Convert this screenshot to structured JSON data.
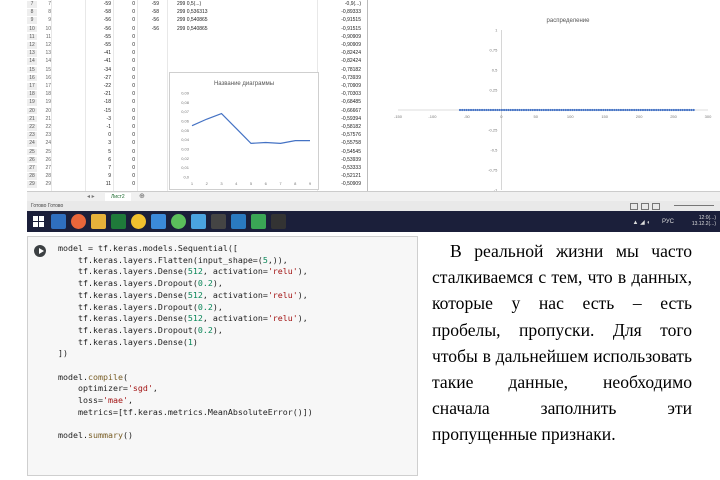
{
  "spreadsheet": {
    "rows": [
      {
        "n": "7",
        "a": "7",
        "b": "-59",
        "c": "0",
        "d": "-59",
        "e": "299",
        "f": "0,5(...)",
        "g": "-0,9(...)"
      },
      {
        "n": "8",
        "a": "8",
        "b": "-58",
        "c": "0",
        "d": "-58",
        "e": "299",
        "f": "0,536313",
        "g": "-0,89333"
      },
      {
        "n": "9",
        "a": "9",
        "b": "-56",
        "c": "0",
        "d": "-56",
        "e": "299",
        "f": "0,540865",
        "g": "-0,91515"
      },
      {
        "n": "10",
        "a": "10",
        "b": "-56",
        "c": "0",
        "d": "-56",
        "e": "299",
        "f": "0,540865",
        "g": "-0,91515"
      },
      {
        "n": "11",
        "a": "11",
        "b": "-55",
        "c": "0",
        "d": "",
        "e": "",
        "f": "",
        "g": "-0,90909"
      },
      {
        "n": "12",
        "a": "12",
        "b": "-55",
        "c": "0",
        "d": "",
        "e": "",
        "f": "",
        "g": "-0,90909"
      },
      {
        "n": "13",
        "a": "13",
        "b": "-41",
        "c": "0",
        "d": "",
        "e": "",
        "f": "",
        "g": "-0,82424"
      },
      {
        "n": "14",
        "a": "14",
        "b": "-41",
        "c": "0",
        "d": "",
        "e": "",
        "f": "",
        "g": "-0,82424"
      },
      {
        "n": "15",
        "a": "15",
        "b": "-34",
        "c": "0",
        "d": "",
        "e": "",
        "f": "",
        "g": "-0,78182"
      },
      {
        "n": "16",
        "a": "16",
        "b": "-27",
        "c": "0",
        "d": "",
        "e": "",
        "f": "",
        "g": "-0,73939"
      },
      {
        "n": "17",
        "a": "17",
        "b": "-22",
        "c": "0",
        "d": "",
        "e": "",
        "f": "",
        "g": "-0,70909"
      },
      {
        "n": "18",
        "a": "18",
        "b": "-21",
        "c": "0",
        "d": "",
        "e": "",
        "f": "",
        "g": "-0,70303"
      },
      {
        "n": "19",
        "a": "19",
        "b": "-18",
        "c": "0",
        "d": "",
        "e": "",
        "f": "",
        "g": "-0,68485"
      },
      {
        "n": "20",
        "a": "20",
        "b": "-15",
        "c": "0",
        "d": "",
        "e": "",
        "f": "",
        "g": "-0,66667"
      },
      {
        "n": "21",
        "a": "21",
        "b": "-3",
        "c": "0",
        "d": "",
        "e": "",
        "f": "",
        "g": "-0,59394"
      },
      {
        "n": "22",
        "a": "22",
        "b": "-1",
        "c": "0",
        "d": "",
        "e": "",
        "f": "",
        "g": "-0,58182"
      },
      {
        "n": "23",
        "a": "23",
        "b": "0",
        "c": "0",
        "d": "",
        "e": "",
        "f": "",
        "g": "-0,57576"
      },
      {
        "n": "24",
        "a": "24",
        "b": "3",
        "c": "0",
        "d": "",
        "e": "",
        "f": "",
        "g": "-0,55758"
      },
      {
        "n": "25",
        "a": "25",
        "b": "5",
        "c": "0",
        "d": "",
        "e": "",
        "f": "",
        "g": "-0,54545"
      },
      {
        "n": "26",
        "a": "26",
        "b": "6",
        "c": "0",
        "d": "",
        "e": "",
        "f": "",
        "g": "-0,53939"
      },
      {
        "n": "27",
        "a": "27",
        "b": "7",
        "c": "0",
        "d": "",
        "e": "",
        "f": "",
        "g": "-0,53333"
      },
      {
        "n": "28",
        "a": "28",
        "b": "9",
        "c": "0",
        "d": "",
        "e": "",
        "f": "",
        "g": "-0,52121"
      },
      {
        "n": "29",
        "a": "29",
        "b": "11",
        "c": "0",
        "d": "",
        "e": "",
        "f": "",
        "g": "-0,50909"
      }
    ],
    "sheet_tab": "Лист2",
    "add_sheet": "⊕",
    "status_left": "Готово   Готово"
  },
  "chart_data": [
    {
      "type": "line",
      "title": "Название диаграммы",
      "x": [
        1,
        2,
        3,
        4,
        5,
        6,
        7,
        8,
        9
      ],
      "series": [
        {
          "values": [
            0.055,
            0.062,
            0.068,
            0.052,
            0.036,
            0.037,
            0.036,
            0.039,
            0.039
          ]
        }
      ],
      "y_ticks": [
        "0,09",
        "0,08",
        "0,07",
        "0,06",
        "0,05",
        "0,04",
        "0,03",
        "0,02",
        "0,01",
        "0,0"
      ],
      "x_ticks": [
        "1",
        "2",
        "3",
        "4",
        "5",
        "6",
        "7",
        "8",
        "9"
      ],
      "ylim": [
        0,
        0.09
      ],
      "color": "#4472c4"
    },
    {
      "type": "scatter",
      "title": "распределение",
      "xlim": [
        -150,
        300
      ],
      "ylim": [
        -1,
        1
      ],
      "x_ticks": [
        "-150",
        "-100",
        "-50",
        "0",
        "50",
        "100",
        "150",
        "200",
        "250",
        "300"
      ],
      "y_ticks": [
        "1",
        "0,75",
        "0,5",
        "0,25",
        "-0,25",
        "-0,5",
        "-0,75",
        "-1"
      ],
      "color": "#4472c4"
    }
  ],
  "taskbar": {
    "tray_time": "12:0(...)",
    "tray_date": "13.12.2(...)",
    "tray_lang": "РУС"
  },
  "notebook": {
    "code_lines": [
      "model = tf.keras.models.Sequential([",
      "    tf.keras.layers.Flatten(input_shape=(5,)),",
      "    tf.keras.layers.Dense(512, activation='relu'),",
      "    tf.keras.layers.Dropout(0.2),",
      "    tf.keras.layers.Dense(512, activation='relu'),",
      "    tf.keras.layers.Dropout(0.2),",
      "    tf.keras.layers.Dense(512, activation='relu'),",
      "    tf.keras.layers.Dropout(0.2),",
      "    tf.keras.layers.Dense(1)",
      "])",
      "",
      "model.compile(",
      "    optimizer='sgd',",
      "    loss='mae',",
      "    metrics=[tf.keras.metrics.MeanAbsoluteError()])",
      "",
      "model.summary()"
    ]
  },
  "paragraph": "В реальной жизни мы часто сталкиваемся с тем, что в данных, которые у нас есть – есть пробелы, пропуски. Для того чтобы в дальнейшем использовать такие данные, необходимо сначала заполнить эти пропущенные признаки."
}
